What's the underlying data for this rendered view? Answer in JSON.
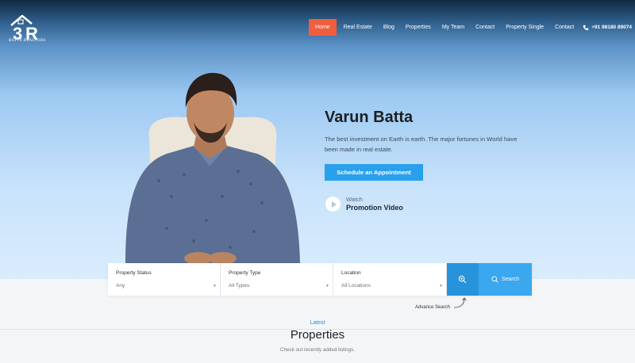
{
  "header": {
    "logo_text": "BATTA REALTORS",
    "nav": [
      "Home",
      "Real Estate",
      "Blog",
      "Properties",
      "My Team",
      "Contact",
      "Property Single",
      "Contact"
    ],
    "phone": "+91 98180 89074"
  },
  "hero": {
    "title": "Varun Batta",
    "description": "The best investment on Earth is earth. The major fortunes in World have been made in real estate.",
    "cta_label": "Schedule an Appointment",
    "watch_label": "Watch",
    "promo_label": "Promotion Video"
  },
  "search": {
    "status_label": "Property Status",
    "status_value": "Any",
    "type_label": "Property Type",
    "type_value": "All Types",
    "location_label": "Location",
    "location_value": "All Locations",
    "search_label": "Search",
    "advance_label": "Advance Search"
  },
  "section": {
    "kicker": "Latest",
    "title": "Properties",
    "subtitle": "Check out recently added listings."
  },
  "colors": {
    "accent": "#f05e3d",
    "primary": "#29a0ec"
  }
}
